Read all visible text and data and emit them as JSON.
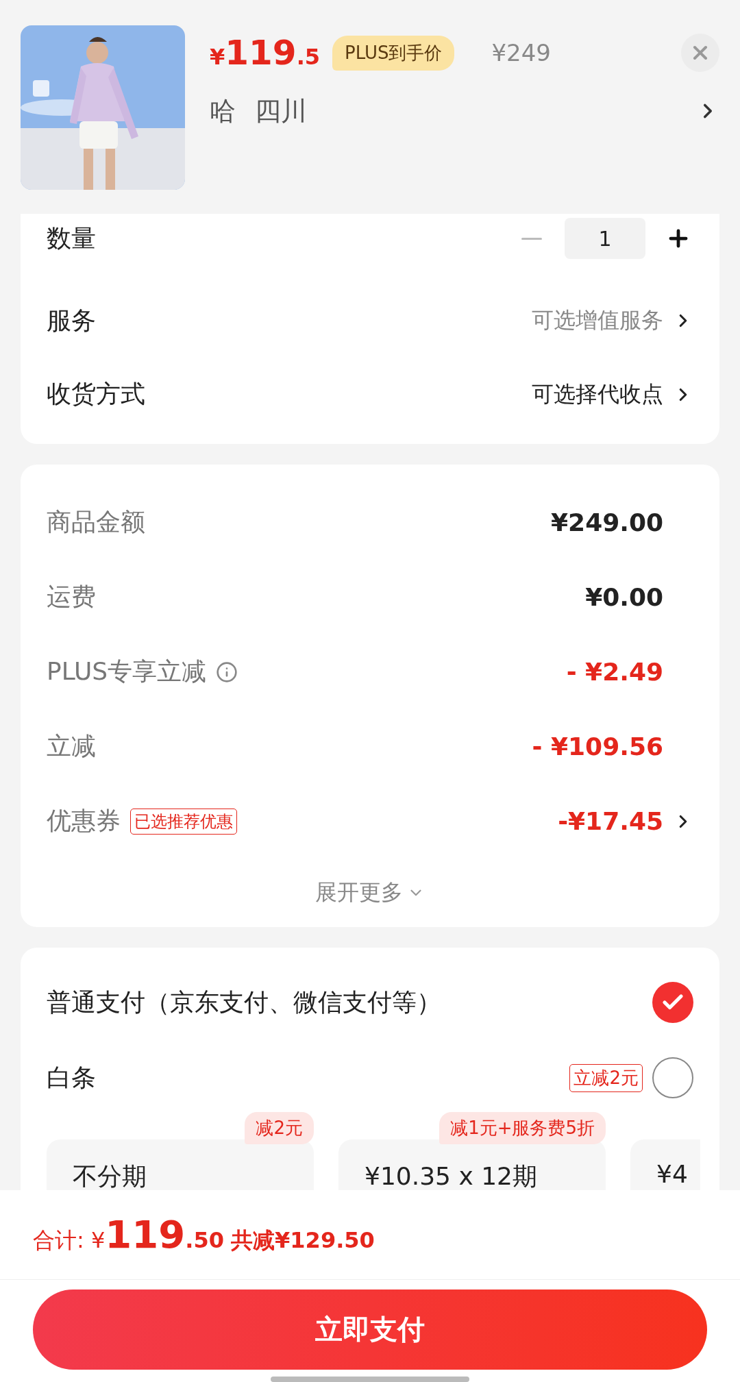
{
  "product": {
    "price_symbol": "¥",
    "price_int": "119",
    "price_dec": ".5",
    "badge": "PLUS到手价",
    "original_price": "¥249",
    "name": "哈",
    "region": "四川"
  },
  "options": [
    {
      "label": "数量",
      "kind": "stepper",
      "value": "1",
      "minus_disabled": true
    },
    {
      "label": "服务",
      "kind": "link",
      "value": "可选增值服务",
      "hint": true
    },
    {
      "label": "收货方式",
      "kind": "link",
      "value": "可选择代收点",
      "hint": false
    }
  ],
  "summary": {
    "rows": [
      {
        "label": "商品金额",
        "amount": "¥249.00",
        "kind": "normal"
      },
      {
        "label": "运费",
        "amount": "¥0.00",
        "kind": "normal"
      },
      {
        "label": "PLUS专享立减",
        "amount": "- ¥2.49",
        "kind": "discount",
        "info": true
      },
      {
        "label": "立减",
        "amount": "- ¥109.56",
        "kind": "discount"
      },
      {
        "label": "优惠券",
        "amount": "-¥17.45",
        "kind": "discount",
        "tag": "已选推荐优惠",
        "link": true
      }
    ],
    "expand": "展开更多"
  },
  "payment": {
    "methods": [
      {
        "name": "普通支付（京东支付、微信支付等）",
        "selected": true
      },
      {
        "name": "白条",
        "selected": false,
        "tag": "立减2元"
      }
    ],
    "plans": [
      {
        "label": "不分期",
        "tag": "减2元"
      },
      {
        "label": "¥10.35 x 12期",
        "tag": "减1元+服务费5折"
      },
      {
        "label": "¥4"
      }
    ]
  },
  "footer": {
    "total_label": "合计:",
    "symbol": "¥",
    "int": "119",
    "dec": ".50",
    "saved": "共减¥129.50",
    "button": "立即支付"
  }
}
